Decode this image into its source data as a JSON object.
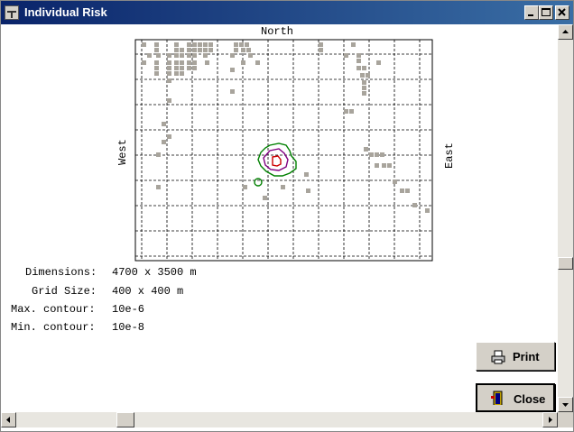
{
  "window": {
    "title": "Individual Risk"
  },
  "plot": {
    "north_label": "North",
    "west_label": "West",
    "east_label": "East",
    "colors": {
      "outer_contour": "#008000",
      "middle_contour": "#800080",
      "inner_contour": "#cc0000",
      "building": "#a8a49c"
    }
  },
  "info": {
    "dimensions_label": "Dimensions:",
    "dimensions_value": "4700 x 3500 m",
    "grid_label": "Grid Size:",
    "grid_value": "400 x 400 m",
    "max_label": "Max. contour:",
    "max_value": "10e-6",
    "min_label": "Min. contour:",
    "min_value": "10e-8"
  },
  "buttons": {
    "print": "Print",
    "close": "Close"
  },
  "icons": {
    "app": "app-icon",
    "print": "printer-icon",
    "close": "door-exit-icon"
  }
}
